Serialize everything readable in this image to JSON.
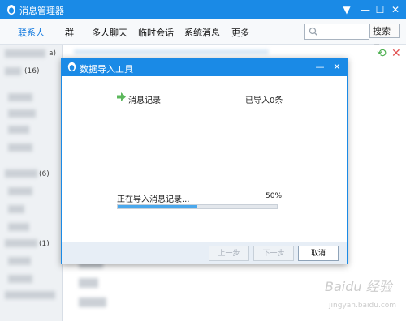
{
  "window": {
    "title": "消息管理器",
    "controls": {
      "menu": "▼",
      "minimize": "—",
      "maximize": "☐",
      "close": "✕"
    }
  },
  "menubar": {
    "items": [
      "联系人",
      "群",
      "多人聊天",
      "临时会话",
      "系统消息",
      "更多"
    ],
    "active_index": 0
  },
  "search": {
    "placeholder": "",
    "button_label": "搜索",
    "button_arrow": "▼"
  },
  "sidebar": {
    "counts": [
      "a)",
      "(16)",
      "(6)",
      "(1)"
    ]
  },
  "actions": {
    "confirm_icon": "refresh-icon",
    "delete_icon": "close-icon"
  },
  "dialog": {
    "title": "数据导入工具",
    "controls": {
      "minimize": "—",
      "close": "✕"
    },
    "item_label": "消息记录",
    "item_status": "已导入0条",
    "progress_label": "正在导入消息记录...",
    "progress_value": 0.5,
    "progress_text": "50%",
    "buttons": {
      "prev": "上一步",
      "next": "下一步",
      "cancel": "取消"
    }
  },
  "watermark": {
    "line1": "Baidu 经验",
    "line2": "jingyan.baidu.com"
  },
  "colors": {
    "titlebar": "#1a8ae6",
    "progress": "#4aa8ec",
    "accent_text": "#1a7ee0"
  }
}
